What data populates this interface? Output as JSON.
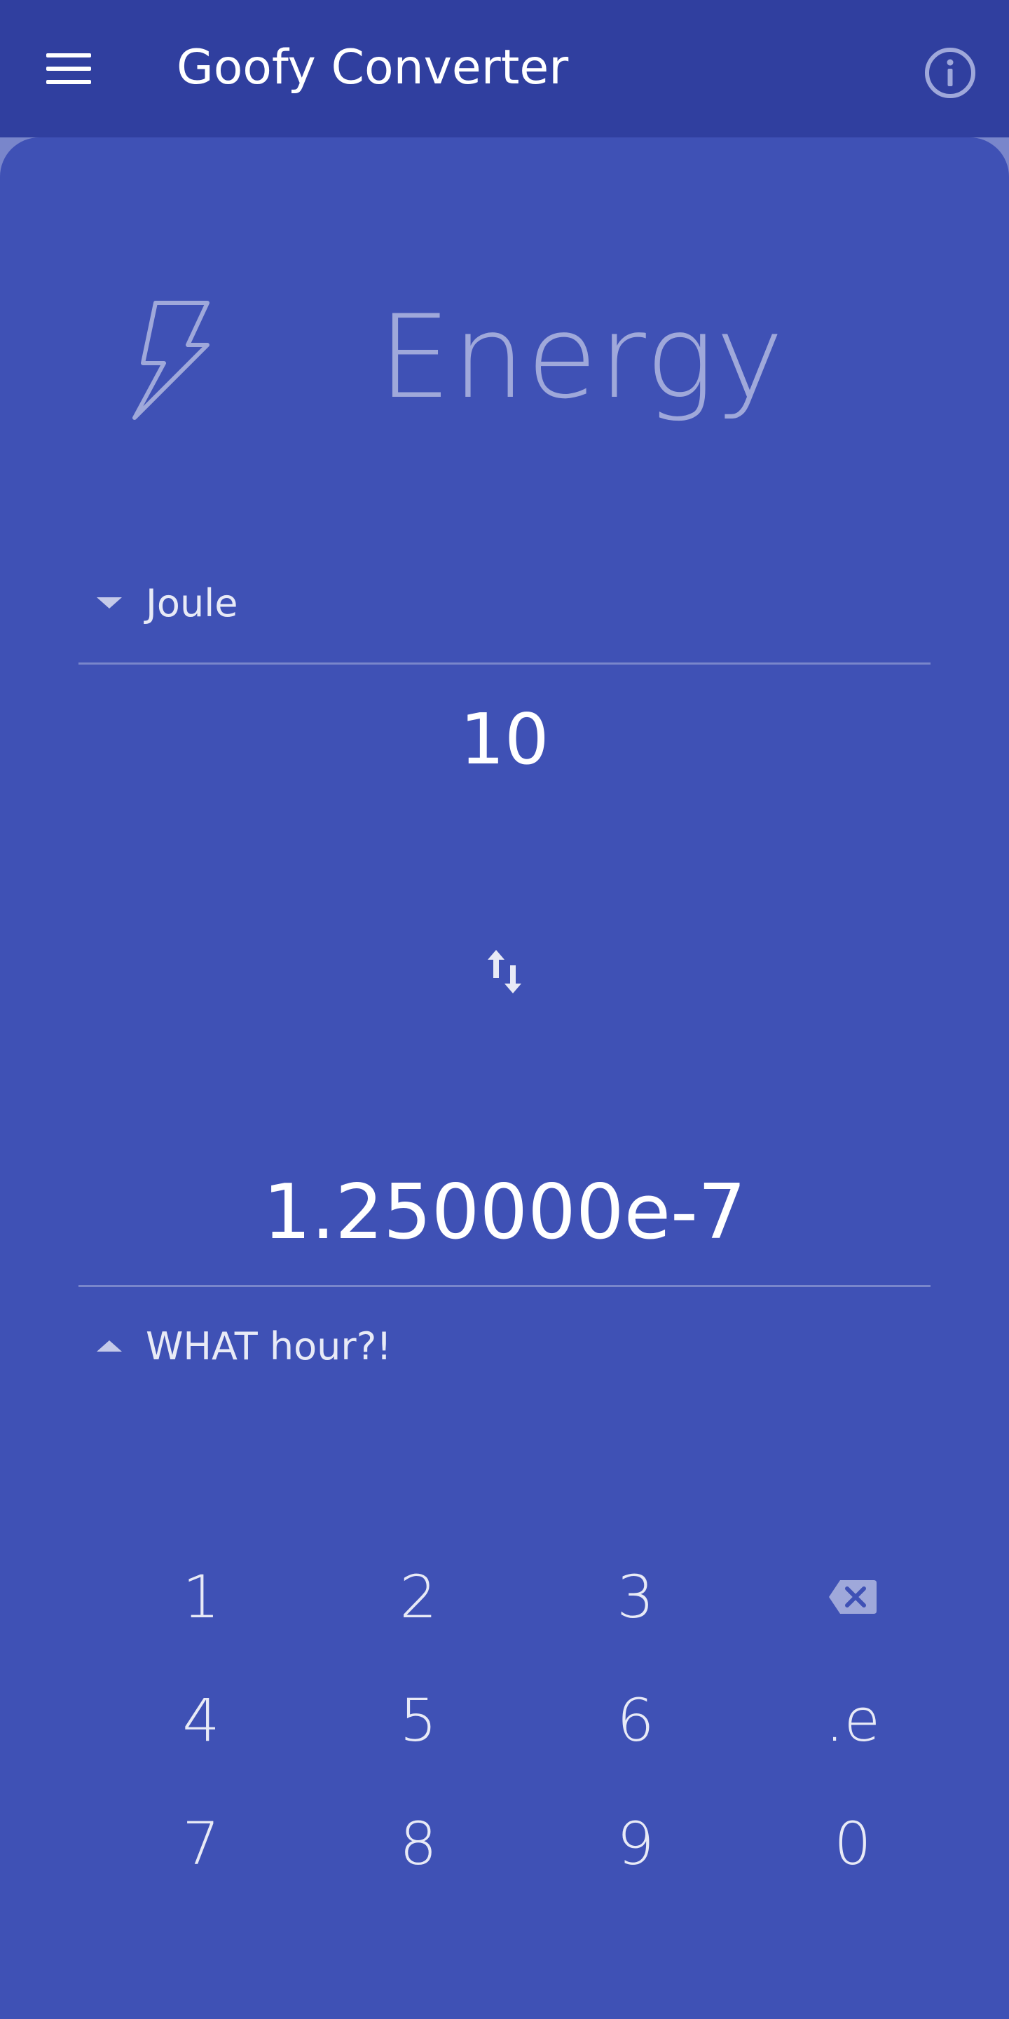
{
  "app_bar": {
    "title": "Goofy Converter",
    "menu_icon": "menu-icon",
    "info_icon": "info-icon"
  },
  "category": {
    "icon": "lightning-bolt-icon",
    "title": "Energy"
  },
  "from": {
    "unit": "Joule",
    "value": "10"
  },
  "swap_icon": "swap-vertical-icon",
  "to": {
    "unit": "WHAT hour?!",
    "value": "1.250000e-7"
  },
  "keypad": {
    "keys": [
      "1",
      "2",
      "3",
      "",
      "4",
      "5",
      "6",
      ".e",
      "7",
      "8",
      "9",
      "0"
    ],
    "backspace_icon": "backspace-icon"
  },
  "colors": {
    "app_bar": "#303f9f",
    "background": "#3f51b5",
    "accent_light": "#9fa8da",
    "divider": "#7986cb"
  }
}
